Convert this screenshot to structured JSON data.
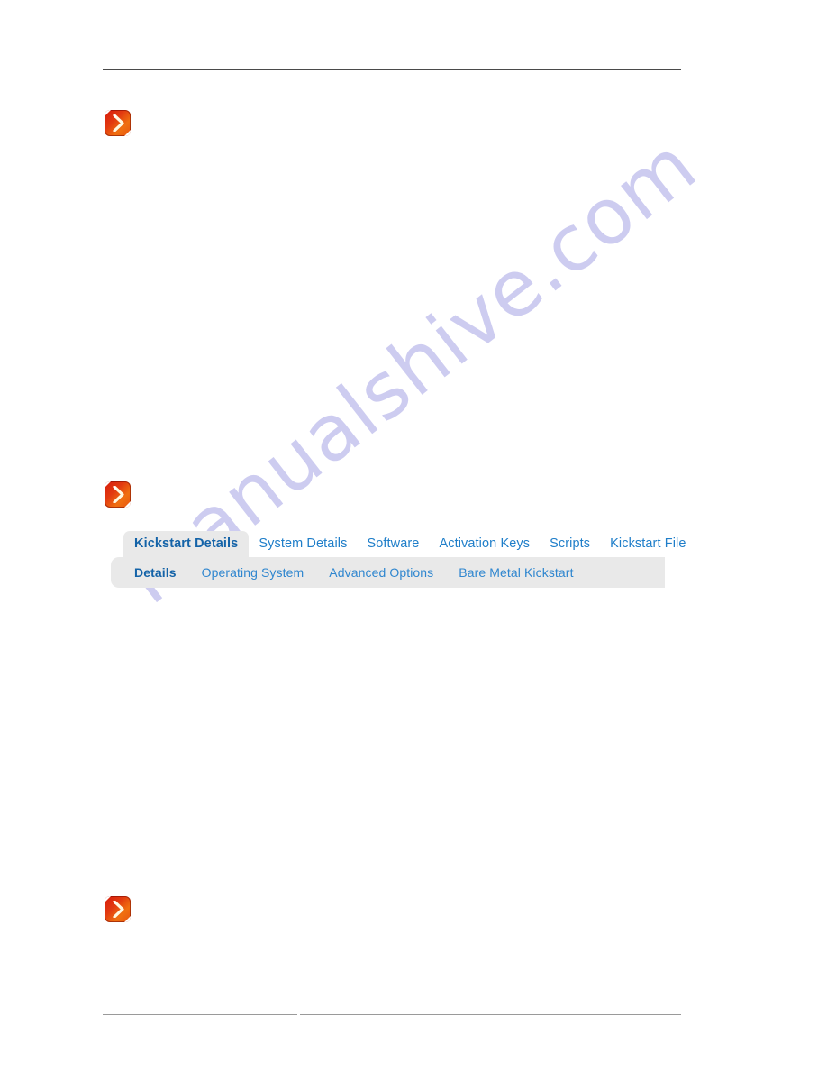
{
  "page": {
    "background_color": "#ffffff",
    "watermark": {
      "text": "manualshive.com",
      "color": "#c9c8ef",
      "angle_deg": -38
    },
    "rules": {
      "top_color": "#4a4a4a",
      "bottom_color": "#9a9a9a"
    }
  },
  "note_icons": [
    {
      "name": "note-chevron-icon",
      "color": "#e23a10",
      "glyph": "chevron-right"
    },
    {
      "name": "note-chevron-icon",
      "color": "#e23a10",
      "glyph": "chevron-right"
    },
    {
      "name": "note-chevron-icon",
      "color": "#e23a10",
      "glyph": "chevron-right"
    }
  ],
  "tab_widget": {
    "accent_color": "#1f7ec9",
    "active_color": "#1463a8",
    "bar_background": "#e9e9e9",
    "tabs": [
      {
        "label": "Kickstart Details",
        "active": true
      },
      {
        "label": "System Details",
        "active": false
      },
      {
        "label": "Software",
        "active": false
      },
      {
        "label": "Activation Keys",
        "active": false
      },
      {
        "label": "Scripts",
        "active": false
      },
      {
        "label": "Kickstart File",
        "active": false
      }
    ],
    "subtabs": [
      {
        "label": "Details",
        "active": true
      },
      {
        "label": "Operating System",
        "active": false
      },
      {
        "label": "Advanced Options",
        "active": false
      },
      {
        "label": "Bare Metal Kickstart",
        "active": false
      }
    ]
  }
}
